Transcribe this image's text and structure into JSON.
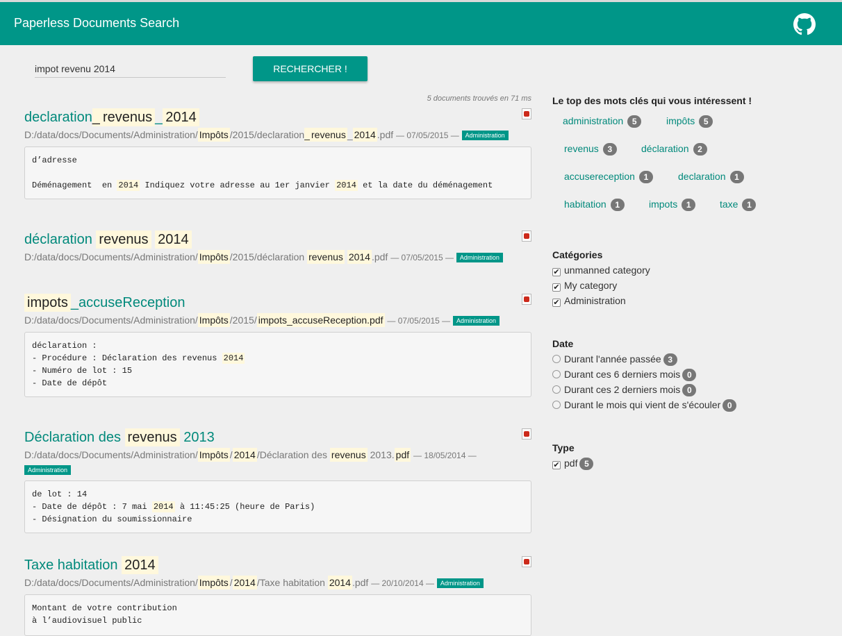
{
  "app": {
    "title": "Paperless Documents Search",
    "github_icon": "github-icon"
  },
  "search": {
    "value": "impot revenu 2014",
    "button_label": "RECHERCHER !"
  },
  "results_summary": "5 documents trouvés en 71 ms",
  "results": [
    {
      "title_parts": [
        {
          "t": "declaration",
          "h": false
        },
        {
          "t": "_",
          "h": true
        },
        {
          "t": "revenus",
          "h": true
        },
        {
          "t": "_",
          "h": false
        },
        {
          "t": "2014",
          "h": true
        }
      ],
      "path_parts": [
        {
          "t": "D:/data/docs/Documents/Administration/",
          "h": false
        },
        {
          "t": "Impôts",
          "h": true
        },
        {
          "t": "/2015/declaration",
          "h": false
        },
        {
          "t": "_",
          "h": true
        },
        {
          "t": "revenus",
          "h": true
        },
        {
          "t": "_",
          "h": false
        },
        {
          "t": "2014",
          "h": true
        },
        {
          "t": ".pdf",
          "h": false
        }
      ],
      "date": "— 07/05/2015 —",
      "category": "Administration",
      "snippet": [
        [
          {
            "t": "d’adresse",
            "h": false
          }
        ],
        [
          {
            "t": "",
            "h": false
          }
        ],
        [
          {
            "t": "Déménagement  en ",
            "h": false
          },
          {
            "t": "2014",
            "h": true
          },
          {
            "t": " Indiquez votre adresse au 1er janvier ",
            "h": false
          },
          {
            "t": "2014",
            "h": true
          },
          {
            "t": " et la date du déménagement",
            "h": false
          }
        ]
      ]
    },
    {
      "title_parts": [
        {
          "t": "déclaration ",
          "h": false
        },
        {
          "t": "revenus",
          "h": true
        },
        {
          "t": " ",
          "h": false
        },
        {
          "t": "2014",
          "h": true
        }
      ],
      "path_parts": [
        {
          "t": "D:/data/docs/Documents/Administration/",
          "h": false
        },
        {
          "t": "Impôts",
          "h": true
        },
        {
          "t": "/2015/déclaration ",
          "h": false
        },
        {
          "t": "revenus",
          "h": true
        },
        {
          "t": " ",
          "h": false
        },
        {
          "t": "2014",
          "h": true
        },
        {
          "t": ".pdf",
          "h": false
        }
      ],
      "date": "— 07/05/2015 —",
      "category": "Administration",
      "snippet": []
    },
    {
      "title_parts": [
        {
          "t": "impots",
          "h": true
        },
        {
          "t": "_accuseReception",
          "h": false
        }
      ],
      "path_parts": [
        {
          "t": "D:/data/docs/Documents/Administration/",
          "h": false
        },
        {
          "t": "Impôts",
          "h": true
        },
        {
          "t": "/2015/",
          "h": false
        },
        {
          "t": "impots_accuseReception.pdf",
          "h": true
        }
      ],
      "date": "— 07/05/2015 —",
      "category": "Administration",
      "snippet": [
        [
          {
            "t": "déclaration :",
            "h": false
          }
        ],
        [
          {
            "t": "- Procédure : Déclaration des revenus ",
            "h": false
          },
          {
            "t": "2014",
            "h": true
          }
        ],
        [
          {
            "t": "- Numéro de lot : 15",
            "h": false
          }
        ],
        [
          {
            "t": "- Date de dépôt",
            "h": false
          }
        ]
      ]
    },
    {
      "title_parts": [
        {
          "t": "Déclaration des ",
          "h": false
        },
        {
          "t": "revenus",
          "h": true
        },
        {
          "t": " 2013",
          "h": false
        }
      ],
      "path_parts": [
        {
          "t": "D:/data/docs/Documents/Administration/",
          "h": false
        },
        {
          "t": "Impôts",
          "h": true
        },
        {
          "t": "/",
          "h": false
        },
        {
          "t": "2014",
          "h": true
        },
        {
          "t": "/Déclaration des ",
          "h": false
        },
        {
          "t": "revenus",
          "h": true
        },
        {
          "t": " 2013.",
          "h": false
        },
        {
          "t": "pdf",
          "h": true
        }
      ],
      "date": "— 18/05/2014 —",
      "category": "Administration",
      "snippet": [
        [
          {
            "t": "de lot : 14",
            "h": false
          }
        ],
        [
          {
            "t": "- Date de dépôt : 7 mai ",
            "h": false
          },
          {
            "t": "2014",
            "h": true
          },
          {
            "t": " à 11:45:25 (heure de Paris)",
            "h": false
          }
        ],
        [
          {
            "t": "- Désignation du soumissionnaire",
            "h": false
          }
        ]
      ]
    },
    {
      "title_parts": [
        {
          "t": "Taxe habitation ",
          "h": false
        },
        {
          "t": "2014",
          "h": true
        }
      ],
      "path_parts": [
        {
          "t": "D:/data/docs/Documents/Administration/",
          "h": false
        },
        {
          "t": "Impôts",
          "h": true
        },
        {
          "t": "/",
          "h": false
        },
        {
          "t": "2014",
          "h": true
        },
        {
          "t": "/Taxe habitation ",
          "h": false
        },
        {
          "t": "2014",
          "h": true
        },
        {
          "t": ".pdf",
          "h": false
        }
      ],
      "date": "— 20/10/2014 —",
      "category": "Administration",
      "snippet": [
        [
          {
            "t": "Montant de votre contribution",
            "h": false
          }
        ],
        [
          {
            "t": "à l’audiovisuel public",
            "h": false
          }
        ]
      ]
    }
  ],
  "keywords": {
    "heading": "Le top des mots clés qui vous intéressent !",
    "items": [
      {
        "label": "administration",
        "count": "5"
      },
      {
        "label": "impôts",
        "count": "5"
      },
      {
        "label": "revenus",
        "count": "3"
      },
      {
        "label": "déclaration",
        "count": "2"
      },
      {
        "label": "accusereception",
        "count": "1"
      },
      {
        "label": "declaration",
        "count": "1"
      },
      {
        "label": "habitation",
        "count": "1"
      },
      {
        "label": "impots",
        "count": "1"
      },
      {
        "label": "taxe",
        "count": "1"
      }
    ]
  },
  "categories": {
    "heading": "Catégories",
    "items": [
      {
        "label": "unmanned category",
        "checked": true
      },
      {
        "label": "My category",
        "checked": true
      },
      {
        "label": "Administration",
        "checked": true
      }
    ]
  },
  "date_filter": {
    "heading": "Date",
    "items": [
      {
        "label": "Durant l'année passée",
        "count": "3"
      },
      {
        "label": "Durant ces 6 derniers mois",
        "count": "0"
      },
      {
        "label": "Durant ces 2 derniers mois",
        "count": "0"
      },
      {
        "label": "Durant le mois qui vient de s'écouler",
        "count": "0"
      }
    ]
  },
  "type_filter": {
    "heading": "Type",
    "items": [
      {
        "label": "pdf",
        "count": "5",
        "checked": true
      }
    ]
  },
  "colors": {
    "primary": "#009688",
    "link": "#00897b",
    "highlight": "#fff8dc",
    "pdf_red": "#cc2a1b"
  }
}
